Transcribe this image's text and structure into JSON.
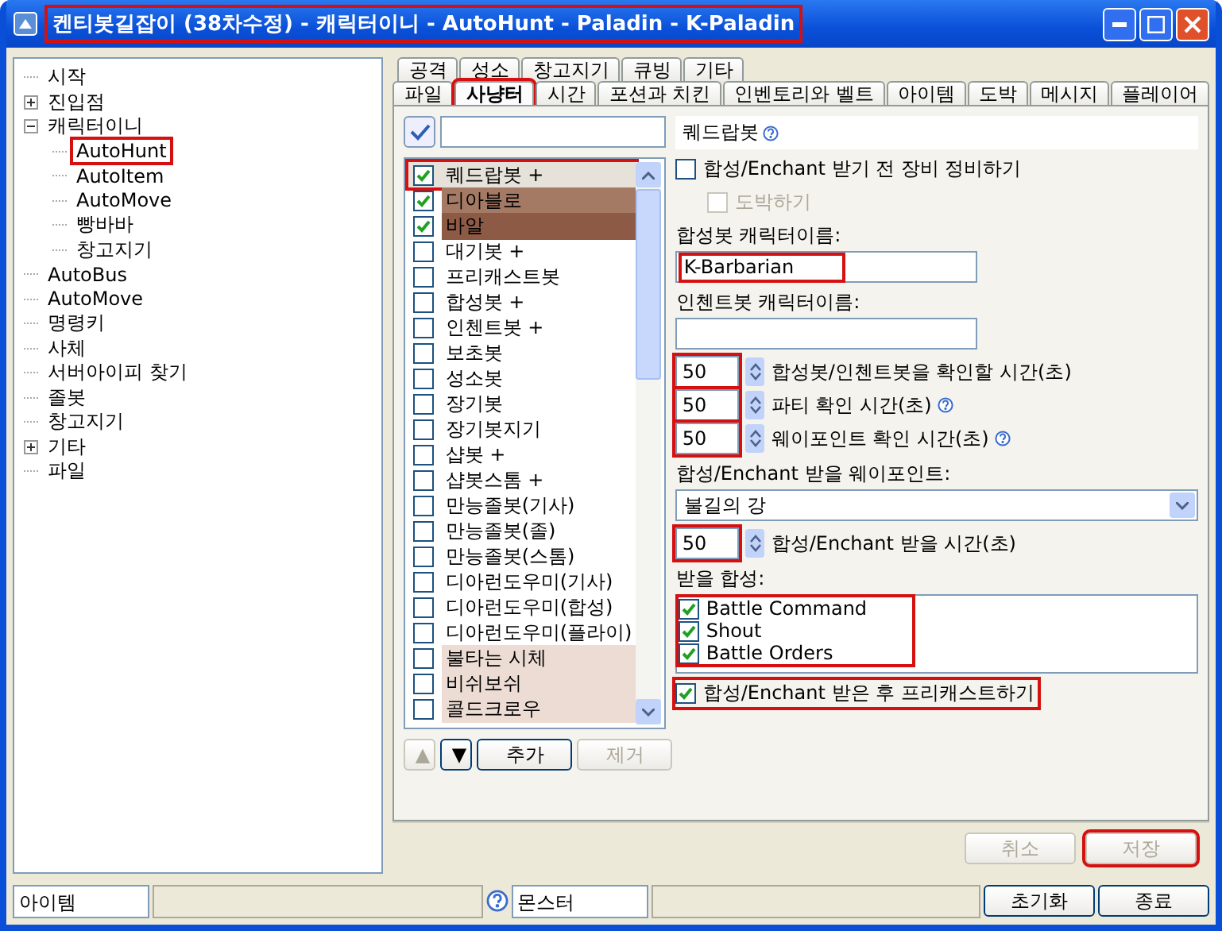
{
  "window": {
    "title": "켄티봇길잡이 (38차수정) - 캐릭터이니 - AutoHunt - Paladin - K-Paladin",
    "highlighted": true
  },
  "tree": [
    {
      "label": "시작",
      "highlighted": false
    },
    {
      "label": "진입점",
      "expanded": false,
      "highlighted": false
    },
    {
      "label": "캐릭터이니",
      "expanded": true,
      "highlighted": false,
      "children": [
        {
          "label": "AutoHunt",
          "highlighted": true
        },
        {
          "label": "AutoItem",
          "highlighted": false
        },
        {
          "label": "AutoMove",
          "highlighted": false
        },
        {
          "label": "빵바바",
          "highlighted": false
        },
        {
          "label": "창고지기",
          "highlighted": false
        }
      ]
    },
    {
      "label": "AutoBus",
      "highlighted": false
    },
    {
      "label": "AutoMove",
      "highlighted": false
    },
    {
      "label": "명령키",
      "highlighted": false
    },
    {
      "label": "사체",
      "highlighted": false
    },
    {
      "label": "서버아이피 찾기",
      "highlighted": false
    },
    {
      "label": "졸봇",
      "highlighted": false
    },
    {
      "label": "창고지기",
      "highlighted": false
    },
    {
      "label": "기타",
      "expanded": false,
      "highlighted": false
    },
    {
      "label": "파일",
      "highlighted": false
    }
  ],
  "tab_rows": [
    [
      {
        "label": "공격",
        "selected": false,
        "highlighted": false
      },
      {
        "label": "성소",
        "selected": false,
        "highlighted": false
      },
      {
        "label": "창고지기",
        "selected": false,
        "highlighted": false
      },
      {
        "label": "큐빙",
        "selected": false,
        "highlighted": false
      },
      {
        "label": "기타",
        "selected": false,
        "highlighted": false
      }
    ],
    [
      {
        "label": "파일",
        "selected": false,
        "highlighted": false
      },
      {
        "label": "사냥터",
        "selected": true,
        "highlighted": true
      },
      {
        "label": "시간",
        "selected": false,
        "highlighted": false
      },
      {
        "label": "포션과 치킨",
        "selected": false,
        "highlighted": false
      },
      {
        "label": "인벤토리와 벨트",
        "selected": false,
        "highlighted": false
      },
      {
        "label": "아이템",
        "selected": false,
        "highlighted": false
      },
      {
        "label": "도박",
        "selected": false,
        "highlighted": false
      },
      {
        "label": "메시지",
        "selected": false,
        "highlighted": false
      },
      {
        "label": "플레이어",
        "selected": false,
        "highlighted": false
      }
    ]
  ],
  "bot_list": [
    {
      "label": "퀘드랍봇 +",
      "checked": true,
      "selected": true,
      "highlighted": true
    },
    {
      "label": "디아블로",
      "checked": true,
      "selected": false,
      "highlighted": false,
      "color": "#a57a64"
    },
    {
      "label": "바알",
      "checked": true,
      "selected": false,
      "highlighted": false,
      "color": "#8d5b45"
    },
    {
      "label": "대기봇 +",
      "checked": false,
      "selected": false,
      "highlighted": false
    },
    {
      "label": "프리캐스트봇",
      "checked": false,
      "selected": false,
      "highlighted": false
    },
    {
      "label": "합성봇 +",
      "checked": false,
      "selected": false,
      "highlighted": false
    },
    {
      "label": "인첸트봇 +",
      "checked": false,
      "selected": false,
      "highlighted": false
    },
    {
      "label": "보초봇",
      "checked": false,
      "selected": false,
      "highlighted": false
    },
    {
      "label": "성소봇",
      "checked": false,
      "selected": false,
      "highlighted": false
    },
    {
      "label": "장기봇",
      "checked": false,
      "selected": false,
      "highlighted": false
    },
    {
      "label": "장기봇지기",
      "checked": false,
      "selected": false,
      "highlighted": false
    },
    {
      "label": "샵봇 +",
      "checked": false,
      "selected": false,
      "highlighted": false
    },
    {
      "label": "샵봇스톰 +",
      "checked": false,
      "selected": false,
      "highlighted": false
    },
    {
      "label": "만능졸봇(기사)",
      "checked": false,
      "selected": false,
      "highlighted": false
    },
    {
      "label": "만능졸봇(졸)",
      "checked": false,
      "selected": false,
      "highlighted": false
    },
    {
      "label": "만능졸봇(스톰)",
      "checked": false,
      "selected": false,
      "highlighted": false
    },
    {
      "label": "디아런도우미(기사)",
      "checked": false,
      "selected": false,
      "highlighted": false
    },
    {
      "label": "디아런도우미(합성)",
      "checked": false,
      "selected": false,
      "highlighted": false
    },
    {
      "label": "디아런도우미(플라이)",
      "checked": false,
      "selected": false,
      "highlighted": false
    },
    {
      "label": "불타는 시체",
      "checked": false,
      "selected": false,
      "highlighted": false,
      "color": "#ecdcd4"
    },
    {
      "label": "비쉬보쉬",
      "checked": false,
      "selected": false,
      "highlighted": false,
      "color": "#ecdcd4"
    },
    {
      "label": "콜드크로우",
      "checked": false,
      "selected": false,
      "highlighted": false,
      "color": "#ecdcd4"
    }
  ],
  "list_buttons": [
    {
      "label": "▲",
      "disabled": true
    },
    {
      "label": "▼",
      "disabled": false
    },
    {
      "label": "추가",
      "disabled": false
    },
    {
      "label": "제거",
      "disabled": true
    }
  ],
  "form": {
    "heading": "퀘드랍봇",
    "repair": {
      "label": "합성/Enchant 받기 전 장비 정비하기",
      "checked": false,
      "disabled": false
    },
    "gamble": {
      "label": "도박하기",
      "checked": false,
      "disabled": true
    },
    "name_fields": [
      {
        "label": "합성봇 캐릭터이름:",
        "value": "K-Barbarian",
        "highlighted": true
      },
      {
        "label": "인첸트봇 캐릭터이름:"
      }
    ],
    "spinners": [
      {
        "value": "50",
        "label": "합성봇/인첸트봇을 확인할 시간(초)",
        "help": false,
        "highlighted": true
      },
      {
        "value": "50",
        "label": "파티 확인 시간(초)",
        "help": true,
        "highlighted": true
      },
      {
        "value": "50",
        "label": "웨이포인트 확인 시간(초)",
        "help": true,
        "highlighted": true
      }
    ],
    "waypoint": {
      "label": "합성/Enchant 받을 웨이포인트:",
      "value": "불길의 강"
    },
    "receive_time": {
      "value": "50",
      "label": "합성/Enchant 받을 시간(초)",
      "highlighted": true
    },
    "skills": {
      "label": "받을 합성:",
      "highlighted": true,
      "items": [
        {
          "label": "Battle Command",
          "checked": true
        },
        {
          "label": "Shout",
          "checked": true
        },
        {
          "label": "Battle Orders",
          "checked": true
        }
      ]
    },
    "precast": {
      "label": "합성/Enchant 받은 후 프리캐스트하기",
      "checked": true,
      "highlighted": true
    }
  },
  "actions": [
    {
      "label": "취소",
      "disabled": true,
      "highlighted": false
    },
    {
      "label": "저장",
      "disabled": true,
      "highlighted": true
    }
  ],
  "status_bar": {
    "item_field": "아이템",
    "monster_field": "몬스터",
    "buttons": [
      "초기화",
      "종료"
    ]
  }
}
